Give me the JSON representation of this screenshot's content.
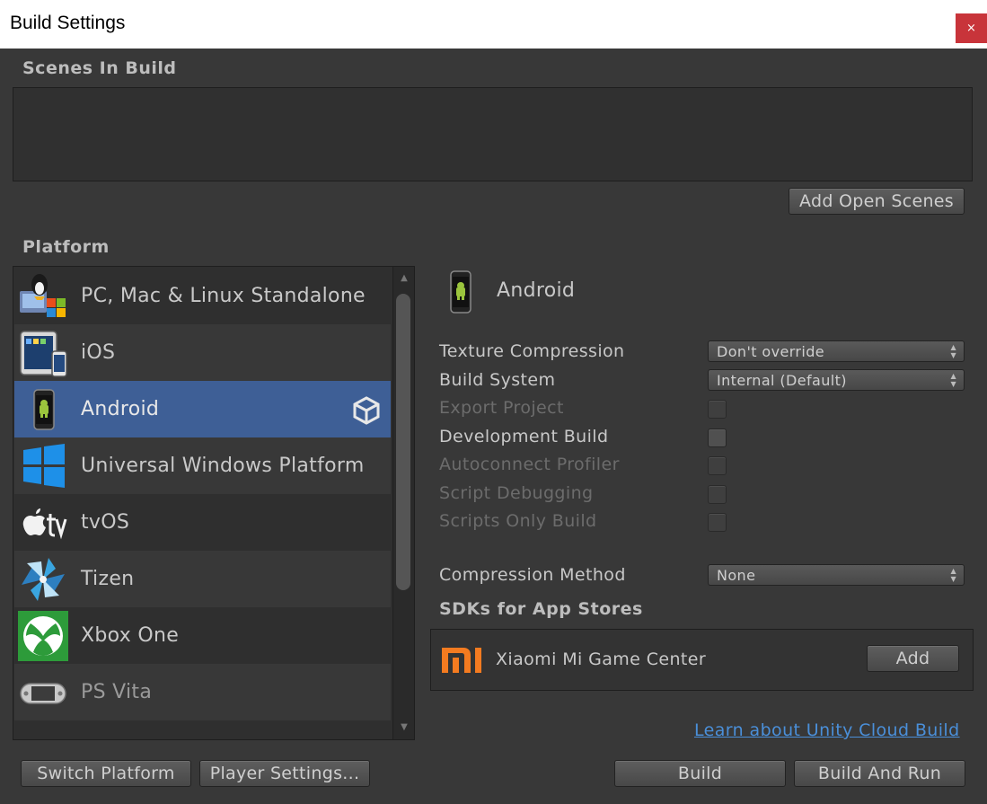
{
  "window": {
    "title": "Build Settings",
    "close_glyph": "×"
  },
  "scenes": {
    "heading": "Scenes In Build",
    "add_open_scenes": "Add Open Scenes"
  },
  "platform": {
    "heading": "Platform",
    "items": [
      {
        "label": "PC, Mac & Linux Standalone",
        "icon": "pc-mac-linux-icon"
      },
      {
        "label": "iOS",
        "icon": "ios-device-icon"
      },
      {
        "label": "Android",
        "icon": "android-phone-icon",
        "selected": true
      },
      {
        "label": "Universal Windows Platform",
        "icon": "windows-logo-icon"
      },
      {
        "label": "tvOS",
        "icon": "apple-tv-icon"
      },
      {
        "label": "Tizen",
        "icon": "tizen-logo-icon"
      },
      {
        "label": "Xbox One",
        "icon": "xbox-logo-icon"
      },
      {
        "label": "PS Vita",
        "icon": "ps-vita-icon"
      }
    ]
  },
  "settings": {
    "platform_title": "Android",
    "texture_compression": {
      "label": "Texture Compression",
      "value": "Don't override"
    },
    "build_system": {
      "label": "Build System",
      "value": "Internal (Default)"
    },
    "export_project": {
      "label": "Export Project"
    },
    "development_build": {
      "label": "Development Build"
    },
    "autoconnect_profiler": {
      "label": "Autoconnect Profiler"
    },
    "script_debugging": {
      "label": "Script Debugging"
    },
    "scripts_only_build": {
      "label": "Scripts Only Build"
    },
    "compression_method": {
      "label": "Compression Method",
      "value": "None"
    },
    "sdks_heading": "SDKs for App Stores",
    "sdk": {
      "name": "Xiaomi Mi Game Center",
      "logo_text": "mi",
      "add_label": "Add"
    },
    "cloud_build_link": "Learn about Unity Cloud Build"
  },
  "footer": {
    "switch_platform": "Switch Platform",
    "player_settings": "Player Settings...",
    "build": "Build",
    "build_and_run": "Build And Run"
  },
  "colors": {
    "selection": "#3e5f96",
    "close_button": "#c8343a",
    "link": "#4a8fd9",
    "xiaomi_orange": "#f47b20"
  }
}
